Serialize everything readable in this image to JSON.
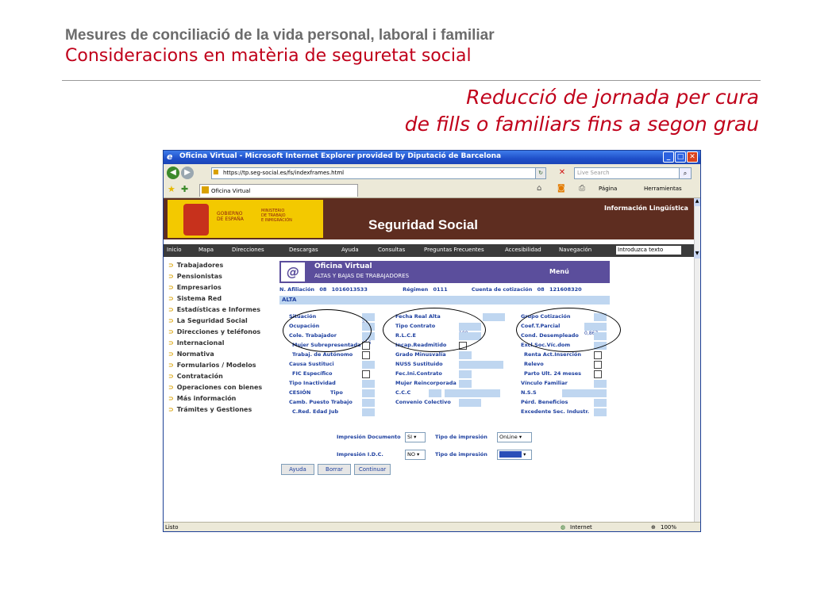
{
  "slide": {
    "header_line1": "Mesures de conciliació de la vida personal, laboral i familiar",
    "header_line2": "Consideracions en matèria de seguretat social",
    "subtitle_line1": "Reducció de jornada per cura",
    "subtitle_line2": "de fills o familiars fins a segon grau"
  },
  "browser": {
    "title": "Oficina Virtual - Microsoft Internet Explorer provided by Diputació de Barcelona",
    "address": "https://tp.seg-social.es/fs/indexframes.html",
    "search_placeholder": "Live Search",
    "tab_label": "Oficina Virtual",
    "toolbar_pagina": "Página",
    "toolbar_herramientas": "Herramientas",
    "status_left": "Listo",
    "status_zone": "Internet",
    "status_zoom": "100%"
  },
  "site": {
    "gov_line1": "GOBIERNO",
    "gov_line2": "DE ESPAÑA",
    "ministry_line1": "MINISTERIO",
    "ministry_line2": "DE TRABAJO",
    "ministry_line3": "E INMIGRACIÓN",
    "title": "Seguridad Social",
    "info_linguistica": "Información Lingüística",
    "menu": [
      "Inicio",
      "Mapa",
      "Direcciones",
      "Descargas",
      "Ayuda",
      "Consultas",
      "Preguntas Frecuentes",
      "Accesibilidad",
      "Navegación"
    ],
    "menu_search": "Introduzca texto",
    "nav": [
      "Trabajadores",
      "Pensionistas",
      "Empresarios",
      "Sistema Red",
      "Estadísticas e Informes",
      "La Seguridad Social",
      "Direcciones y teléfonos",
      "Internacional",
      "Normativa",
      "Formularios / Modelos",
      "Contratación",
      "Operaciones con bienes",
      "Más información",
      "Trámites y Gestiones"
    ]
  },
  "form": {
    "ov_title": "Oficina Virtual",
    "ov_subtitle": "ALTAS Y BAJAS DE TRABAJADORES",
    "ov_menu": "Menú",
    "afil_label": "N. Afiliación",
    "afil_prov": "08",
    "afil_num": "1016013533",
    "regimen_label": "Régimen",
    "regimen_value": "0111",
    "ccc_label": "Cuenta de cotización",
    "ccc_prov": "08",
    "ccc_num": "121608320",
    "alta": "ALTA",
    "col1": [
      {
        "label": "Situación",
        "value": "01"
      },
      {
        "label": "Ocupación",
        "value": ""
      },
      {
        "label": "Cole. Trabajador",
        "value": "016"
      },
      {
        "label": "Mujer Subrepresentada",
        "value": ""
      },
      {
        "label": "Trabaj. de Autónomo",
        "value": ""
      },
      {
        "label": "Causa Sustituci",
        "value": ""
      },
      {
        "label": "FIC Específico",
        "value": ""
      },
      {
        "label": "Tipo Inactividad",
        "value": ""
      },
      {
        "label": "CESIÓN",
        "value": ""
      },
      {
        "label": "Camb. Puesto Trabajo",
        "value": ""
      },
      {
        "label": "C.Red. Edad Jub",
        "value": ""
      }
    ],
    "tipo_label": "Tipo",
    "col2": [
      {
        "label": "Fecha Real Alta",
        "value": ""
      },
      {
        "label": "Tipo Contrato",
        "value": "100"
      },
      {
        "label": "R.L.C.E",
        "value": ""
      },
      {
        "label": "Incap.Readmitido",
        "value": ""
      },
      {
        "label": "Grado Minusvalía",
        "value": ""
      },
      {
        "label": "NUSS Sustituido",
        "value": ""
      },
      {
        "label": "Fec.Ini.Contrato",
        "value": ""
      },
      {
        "label": "Mujer Reincorporada",
        "value": ""
      },
      {
        "label": "C.C.C",
        "value": ""
      },
      {
        "label": "Convenio Colectivo",
        "value": ""
      }
    ],
    "col3": [
      {
        "label": "Grupo Cotización",
        "value": ""
      },
      {
        "label": "Coef.T.Parcial",
        "value": "0,867"
      },
      {
        "label": "Cond. Desempleado",
        "value": ""
      },
      {
        "label": "Excl.Soc.Víc.dom",
        "value": ""
      },
      {
        "label": "Renta Act.Inserción",
        "value": ""
      },
      {
        "label": "Relevo",
        "value": ""
      },
      {
        "label": "Parto Ult. 24 meses",
        "value": ""
      },
      {
        "label": "Vínculo Familiar",
        "value": ""
      },
      {
        "label": "N.S.S",
        "value": ""
      },
      {
        "label": "Pérd. Beneficios",
        "value": ""
      },
      {
        "label": "Excedente Sec. Industr.",
        "value": ""
      }
    ],
    "impresion_doc_label": "Impresión Documento",
    "impresion_doc_value": "SI",
    "tipo_impresion_label": "Tipo de impresión",
    "tipo_impresion_value": "OnLine",
    "impresion_idc_label": "Impresión I.D.C.",
    "impresion_idc_value": "NO",
    "tipo_impresion2_label": "Tipo de impresión",
    "btn_ayuda": "Ayuda",
    "btn_borrar": "Borrar",
    "btn_continuar": "Continuar"
  }
}
